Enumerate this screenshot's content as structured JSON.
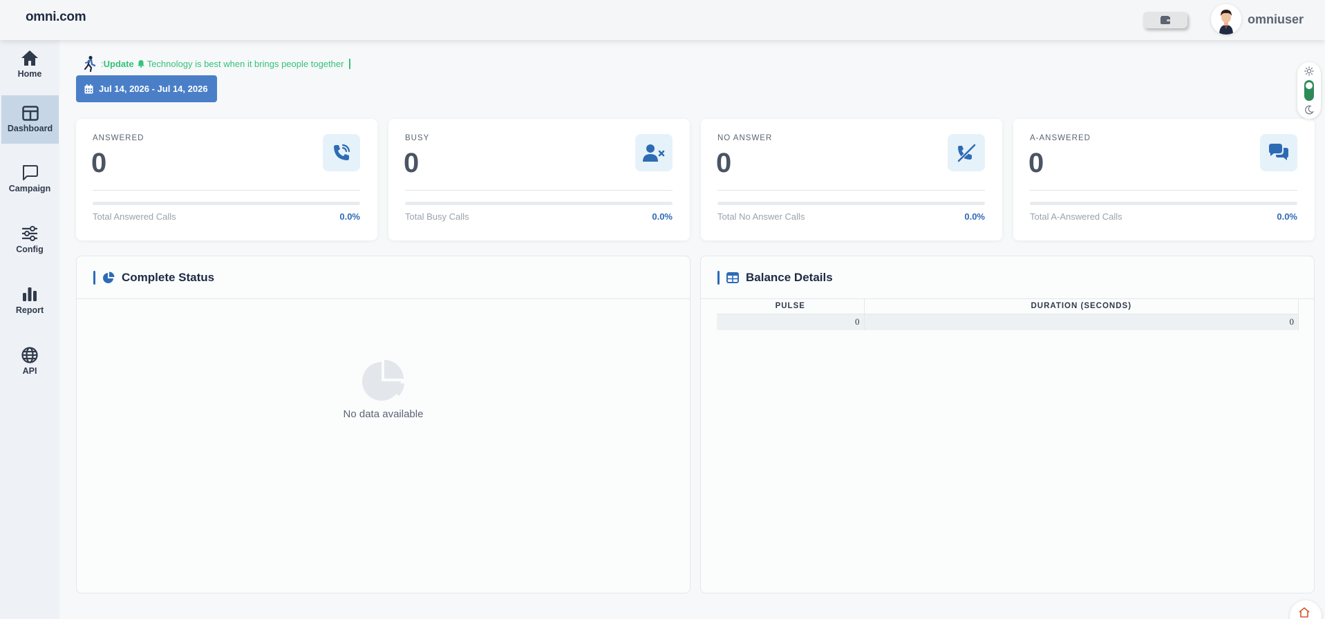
{
  "header": {
    "brand": "omni.com",
    "username": "omniuser"
  },
  "sidebar": {
    "items": [
      {
        "label": "Home",
        "icon": "home-icon",
        "active": false
      },
      {
        "label": "Dashboard",
        "icon": "dashboard-icon",
        "active": true
      },
      {
        "label": "Campaign",
        "icon": "chat-icon",
        "active": false
      },
      {
        "label": "Config",
        "icon": "sliders-icon",
        "active": false
      },
      {
        "label": "Report",
        "icon": "bar-chart-icon",
        "active": false
      },
      {
        "label": "API",
        "icon": "globe-icon",
        "active": false
      }
    ]
  },
  "update": {
    "prefix": ": ",
    "label": "Update",
    "message": "Technology is best when it brings people together"
  },
  "date_range": "Jul 14, 2026 - Jul 14, 2026",
  "stats": [
    {
      "title": "ANSWERED",
      "value": "0",
      "footer": "Total Answered Calls",
      "percent": "0.0%",
      "icon": "phone-call-icon"
    },
    {
      "title": "BUSY",
      "value": "0",
      "footer": "Total Busy Calls",
      "percent": "0.0%",
      "icon": "user-x-icon"
    },
    {
      "title": "NO ANSWER",
      "value": "0",
      "footer": "Total No Answer Calls",
      "percent": "0.0%",
      "icon": "phone-slash-icon"
    },
    {
      "title": "A-ANSWERED",
      "value": "0",
      "footer": "Total A-Answered Calls",
      "percent": "0.0%",
      "icon": "chat-bubbles-icon"
    }
  ],
  "complete_status": {
    "title": "Complete Status",
    "empty_text": "No data available"
  },
  "balance": {
    "title": "Balance Details",
    "columns": [
      "PULSE",
      "DURATION (SECONDS)"
    ],
    "rows": [
      [
        "0",
        "0"
      ]
    ]
  },
  "colors": {
    "accent": "#4a7fc8",
    "brand_blue": "#2e6bb5",
    "update_green": "#34c27a",
    "toggle_green": "#2e8b57"
  }
}
